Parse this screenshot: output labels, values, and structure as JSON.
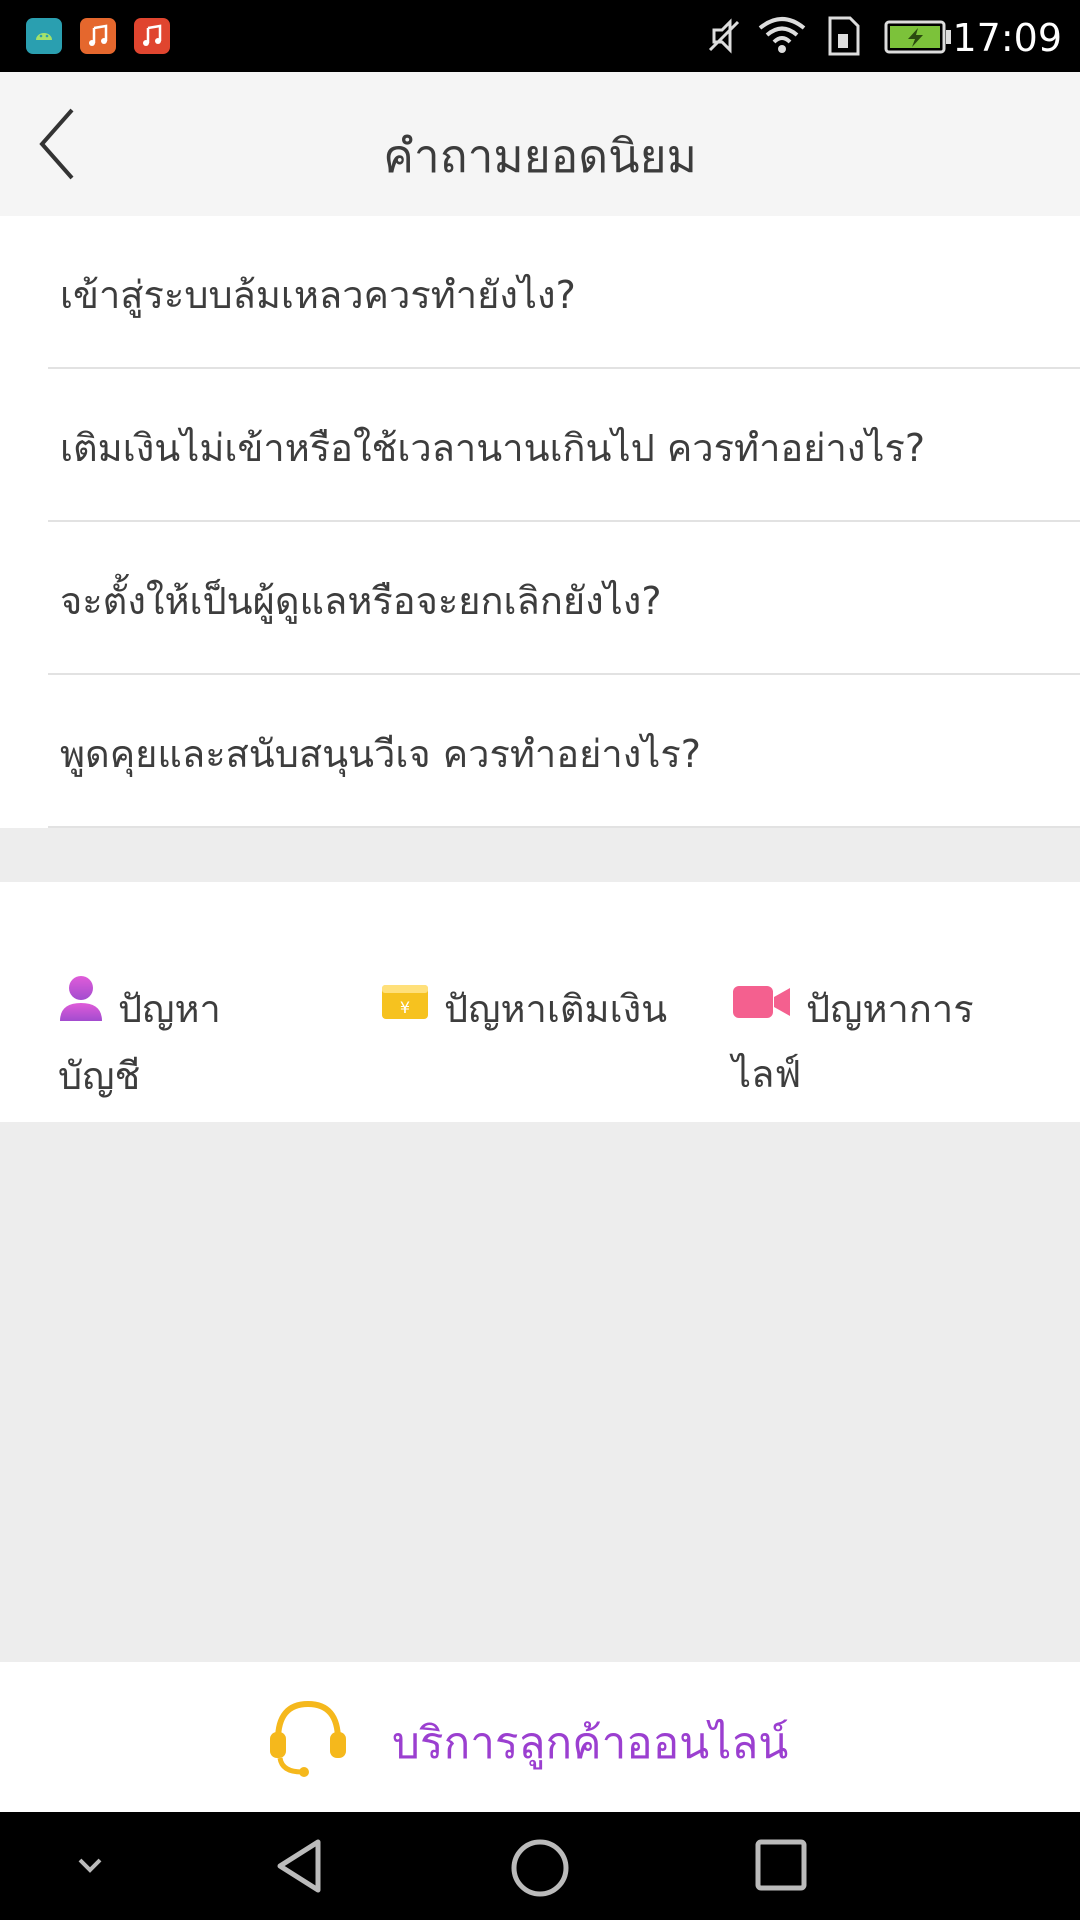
{
  "status_bar": {
    "time": "17:09",
    "icons": [
      "android-app-icon",
      "music-app-icon",
      "music-app-icon",
      "silent-icon",
      "wifi-icon",
      "sim-icon",
      "battery-charging-icon"
    ]
  },
  "header": {
    "title": "คำถามยอดนิยม",
    "back_icon": "chevron-left-icon"
  },
  "faq": [
    {
      "question": "เข้าสู่ระบบล้มเหลวควรทำยังไง?"
    },
    {
      "question": "เติมเงินไม่เข้าหรือใช้เวลานานเกินไป ควรทำอย่างไร?"
    },
    {
      "question": "จะตั้งให้เป็นผู้ดูแลหรือจะยกเลิกยังไง?"
    },
    {
      "question": "พูดคุยและสนับสนุนวีเจ ควรทำอย่างไร?"
    }
  ],
  "categories": [
    {
      "line1": "ปัญหา",
      "line2": "บัญชี",
      "icon": "user-icon",
      "color": "#c24fd6"
    },
    {
      "line1": "ปัญหาเติมเงิน",
      "line2": "",
      "icon": "wallet-icon",
      "color": "#f5c518"
    },
    {
      "line1": "ปัญหาการ",
      "line2": "ไลฟ์",
      "icon": "video-camera-icon",
      "color": "#f4608f"
    }
  ],
  "support": {
    "label": "บริการลูกค้าออนไลน์",
    "icon": "headset-icon",
    "label_color": "#9b3fd0",
    "icon_color": "#f5b81c"
  },
  "nav_bar": {
    "icons": [
      "chevron-down-icon",
      "back-triangle-icon",
      "home-circle-icon",
      "recents-square-icon"
    ]
  }
}
